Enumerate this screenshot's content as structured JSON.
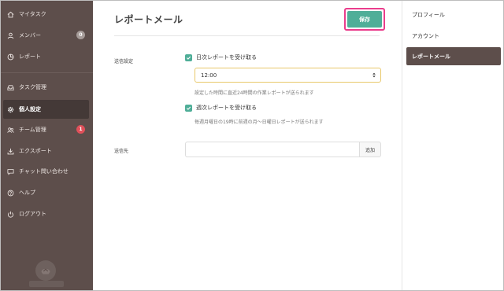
{
  "sidebar": {
    "items": [
      {
        "label": "マイタスク",
        "icon": "home-icon"
      },
      {
        "label": "メンバー",
        "icon": "person-icon",
        "badge": "0"
      },
      {
        "label": "レポート",
        "icon": "report-icon"
      },
      {
        "label": "タスク管理",
        "icon": "inbox-icon"
      },
      {
        "label": "個人設定",
        "icon": "gear-icon"
      },
      {
        "label": "チーム管理",
        "icon": "team-icon",
        "badge": "1"
      },
      {
        "label": "エクスポート",
        "icon": "download-icon"
      },
      {
        "label": "チャット問い合わせ",
        "icon": "chat-icon"
      },
      {
        "label": "ヘルプ",
        "icon": "help-icon"
      },
      {
        "label": "ログアウト",
        "icon": "power-icon"
      }
    ],
    "active": "個人設定"
  },
  "main": {
    "title": "レポートメール",
    "save_label": "保存",
    "send_settings_label": "送信設定",
    "daily": {
      "label": "日次レポートを受け取る",
      "checked": true,
      "time_value": "12:00",
      "help": "設定した時間に直近24時間の作業レポートが送られます"
    },
    "weekly": {
      "label": "週次レポートを受け取る",
      "checked": true,
      "help": "毎週月曜日の19時に前週の月〜日曜日レポートが送られます"
    },
    "destination_label": "送信先",
    "destination_value": "",
    "add_label": "追加"
  },
  "rightnav": {
    "items": [
      "プロフィール",
      "アカウント",
      "レポートメール"
    ],
    "active": "レポートメール"
  },
  "colors": {
    "sidebar": "#5d4e4b",
    "accent": "#4fae98",
    "highlight": "#ea3d8c",
    "badge_alert": "#e0505a"
  }
}
